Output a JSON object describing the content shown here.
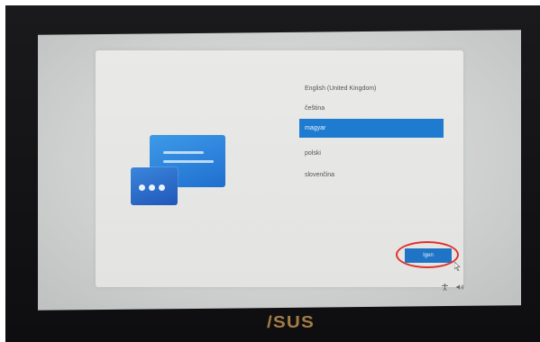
{
  "languages": [
    {
      "label": "English (United Kingdom)",
      "selected": false
    },
    {
      "label": "čeština",
      "selected": false
    },
    {
      "label": "magyar",
      "selected": true
    },
    {
      "label": "polski",
      "selected": false
    },
    {
      "label": "slovenčina",
      "selected": false
    }
  ],
  "next_button": {
    "label": "Igen"
  },
  "brand": {
    "text": "/SUS"
  },
  "icons": {
    "illustration": "chat-window-illustration",
    "cursor": "mouse-pointer-icon",
    "accessibility": "accessibility-icon",
    "volume": "volume-icon"
  },
  "colors": {
    "accent": "#1e7bcf",
    "annotation": "#e0312f",
    "brand": "#a47d45"
  }
}
